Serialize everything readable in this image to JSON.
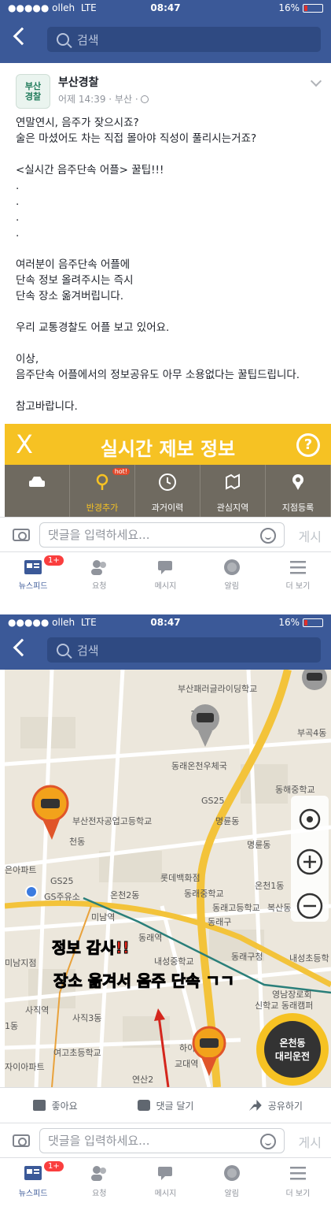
{
  "status": {
    "carrier": "●●●●● olleh",
    "network": "LTE",
    "time": "08:47",
    "battery": "16%"
  },
  "search": {
    "placeholder": "검색"
  },
  "post": {
    "page_name": "부산경찰",
    "avatar_text": "부산\n경찰",
    "meta": "어제 14:39 · 부산 · ",
    "lines": [
      "연말연시, 음주가 잦으시죠?",
      "술은 마셨어도 차는 직접 몰아야 직성이 풀리시는거죠?",
      "",
      "<실시간 음주단속 어플> 꿀팁!!!",
      ".",
      ".",
      ".",
      ".",
      "",
      "여러분이 음주단속 어플에",
      "단속 정보 올려주시는 즉시",
      "단속 장소 옮겨버립니다.",
      "",
      "우리 교통경찰도 어플 보고 있어요.",
      "",
      "이상,",
      "음주단속 어플에서의 정보공유도 아무 소용없다는 꿀팁드립니다.",
      "",
      "참고바랍니다."
    ]
  },
  "app_banner": {
    "title": "실시간 제보 정보",
    "close": "X",
    "help": "?",
    "tools": [
      {
        "label": "",
        "icon": "car-icon"
      },
      {
        "label": "반경추가",
        "icon": "location-pin-icon",
        "badge": "hot!"
      },
      {
        "label": "과거이력",
        "icon": "clock-icon"
      },
      {
        "label": "관심지역",
        "icon": "map-pin-icon"
      },
      {
        "label": "지점등록",
        "icon": "pin-icon"
      }
    ]
  },
  "composer": {
    "placeholder": "댓글을 입력하세요...",
    "post_label": "게시"
  },
  "tabbar": {
    "items": [
      {
        "label": "뉴스피드",
        "badge": "1+"
      },
      {
        "label": "요청"
      },
      {
        "label": "메시지"
      },
      {
        "label": "알림"
      },
      {
        "label": "더 보기"
      }
    ]
  },
  "map": {
    "labels": {
      "l1": "부산패러글라이딩학교",
      "l2": "부곡4동",
      "l3": "동래온천우체국",
      "l4": "동해중학교",
      "l5": "GS25",
      "l6": "부산전자공업고등학교",
      "l7": "천동",
      "l8": "명륜동",
      "l9": "명륜동",
      "l10": "GS25",
      "l11": "롯데백화점",
      "l12": "은아파트",
      "l13": "GS주유소",
      "l14": "온천2동",
      "l15": "동래중학교",
      "l16": "동래고등학교",
      "l17": "미남역",
      "l18": "복산동",
      "l19": "동래구",
      "l20": "동래역",
      "l21": "동래구청",
      "l22": "내성초등학",
      "l23": "미남지점",
      "l24": "내성중학교",
      "l25": "사직역",
      "l26": "영남장로회",
      "l27": "신학교 동래캠퍼",
      "l28": "사직3동",
      "l29": "1동",
      "l30": "여고초등학교",
      "l31": "교대역",
      "l32": "하이",
      "l33": "자이아파트",
      "l34": "1동",
      "l35": "연산2",
      "l36": "온천1동"
    },
    "overlay1": "정보 감사!!",
    "overlay2": "장소 옮겨서 음주 단속 ㄱㄱ",
    "driver_badge_line1": "온천동",
    "driver_badge_line2": "대리운전"
  },
  "post_actions": {
    "like": "좋아요",
    "comment": "댓글 달기",
    "share": "공유하기"
  },
  "colors": {
    "facebook_blue": "#3b5998",
    "app_yellow": "#f6c223",
    "badge_red": "#fa3e3e",
    "map_road_yellow": "#f3c33a",
    "overlay_red": "#e62a1f"
  }
}
